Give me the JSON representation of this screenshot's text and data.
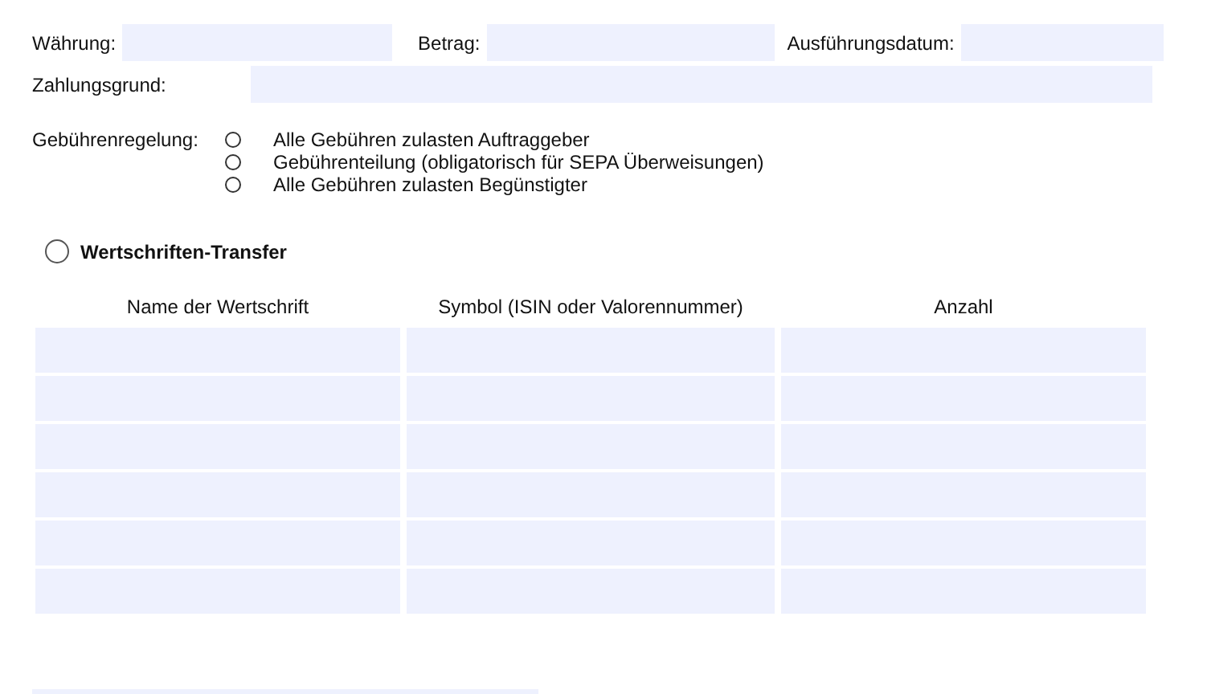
{
  "fields_row": [
    {
      "label": "Währung:",
      "kind": "short"
    },
    {
      "label": "Betrag:",
      "kind": "medium"
    },
    {
      "label": "Ausführungsdatum:",
      "kind": "grow"
    }
  ],
  "reason": {
    "label": "Zahlungsgrund:"
  },
  "fees": {
    "label": "Gebührenregelung:",
    "options": [
      {
        "label": "Alle Gebühren zulasten Auftraggeber",
        "selected": false
      },
      {
        "label": "Gebührenteilung (obligatorisch für SEPA Überweisungen)",
        "selected": false
      },
      {
        "label": "Alle Gebühren zulasten Begünstigter",
        "selected": false
      }
    ]
  },
  "securities": {
    "label": "Wertschriften-Transfer",
    "selected": false,
    "columns": [
      "Name der Wertschrift",
      "Symbol (ISIN oder Valorennummer)",
      "Anzahl"
    ],
    "rows": [
      {
        "kind": "empty"
      },
      {
        "kind": "empty"
      },
      {
        "kind": "empty"
      },
      {
        "kind": "empty"
      },
      {
        "kind": "empty"
      },
      {
        "kind": "empty"
      }
    ]
  },
  "footer_field": {
    "kind": "partial"
  }
}
